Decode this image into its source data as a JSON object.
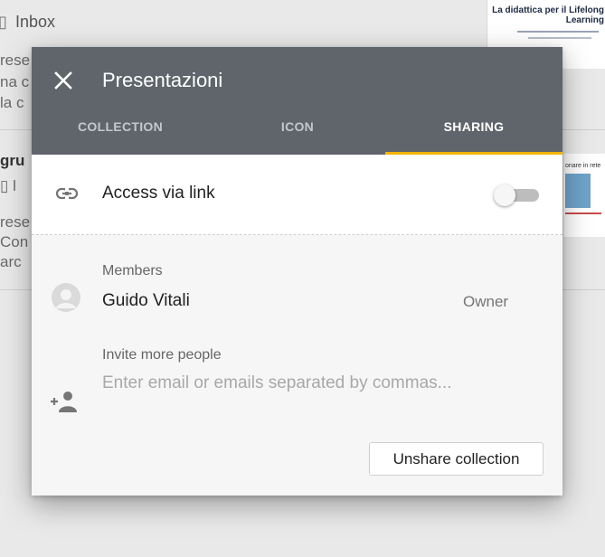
{
  "background": {
    "inbox_label": "Inbox",
    "checkbox_glyph": "▯",
    "fragments": [
      "rese",
      "na c",
      "la c",
      "gru",
      "▯ l",
      "rese",
      "Con",
      "arc"
    ],
    "thumb_title": "La didattica per il Lifelong Learning",
    "thumb_text": "onare in rete"
  },
  "dialog": {
    "title": "Presentazioni",
    "close_icon": "close-icon",
    "tabs": [
      {
        "label": "COLLECTION",
        "active": false
      },
      {
        "label": "ICON",
        "active": false
      },
      {
        "label": "SHARING",
        "active": true
      }
    ],
    "tab_indicator_color": "#f4b400",
    "header_color": "#5f656b",
    "access_link": {
      "label": "Access via link",
      "icon": "link-icon",
      "enabled": false
    },
    "members": {
      "label": "Members",
      "list": [
        {
          "name": "Guido Vitali",
          "role": "Owner",
          "avatar": "avatar-placeholder-icon"
        }
      ]
    },
    "invite": {
      "label": "Invite more people",
      "placeholder": "Enter email or emails separated by commas...",
      "value": "",
      "icon": "add-person-icon"
    },
    "unshare_label": "Unshare collection"
  }
}
